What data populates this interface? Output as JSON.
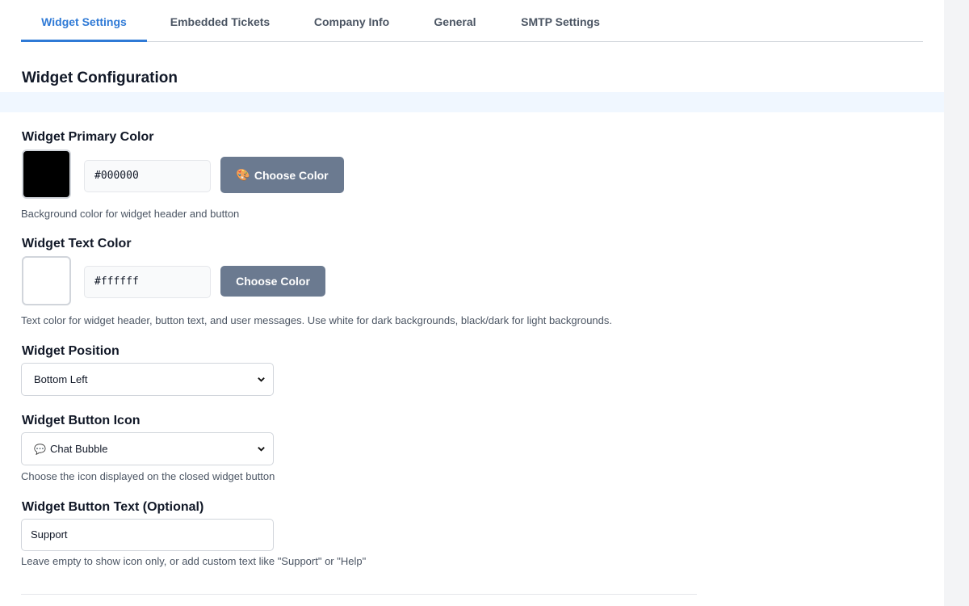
{
  "tabs": [
    {
      "label": "Widget Settings",
      "active": true
    },
    {
      "label": "Embedded Tickets",
      "active": false
    },
    {
      "label": "Company Info",
      "active": false
    },
    {
      "label": "General",
      "active": false
    },
    {
      "label": "SMTP Settings",
      "active": false
    }
  ],
  "section_title": "Widget Configuration",
  "primary_color": {
    "label": "Widget Primary Color",
    "value": "#000000",
    "swatch": "#000000",
    "button_label": "Choose Color",
    "button_icon": "palette-icon",
    "help": "Background color for widget header and button"
  },
  "text_color": {
    "label": "Widget Text Color",
    "value": "#ffffff",
    "swatch": "#ffffff",
    "button_label": "Choose Color",
    "help": "Text color for widget header, button text, and user messages. Use white for dark backgrounds, black/dark for light backgrounds."
  },
  "position": {
    "label": "Widget Position",
    "selected": "Bottom Left"
  },
  "button_icon": {
    "label": "Widget Button Icon",
    "selected": "Chat Bubble",
    "selected_icon": "chat-bubble-icon",
    "help": "Choose the icon displayed on the closed widget button"
  },
  "button_text": {
    "label": "Widget Button Text (Optional)",
    "value": "Support",
    "help": "Leave empty to show icon only, or add custom text like \"Support\" or \"Help\""
  },
  "colors": {
    "accent": "#2f7ad6",
    "button": "#6b7a90",
    "band": "#f0f7ff"
  }
}
